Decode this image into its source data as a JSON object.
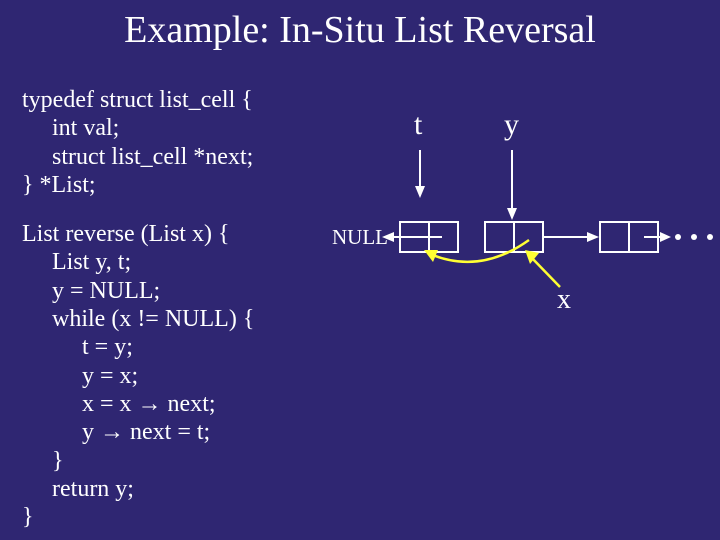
{
  "title": "Example: In-Situ List Reversal",
  "typedef": {
    "l1": "typedef struct list_cell {",
    "l2": "int val;",
    "l3": "struct list_cell *next;",
    "l4": "} *List;"
  },
  "func": {
    "l1": "List reverse (List x) {",
    "l2": "List y, t;",
    "l3": "y = NULL;",
    "l4": "while (x != NULL) {",
    "l5": "t = y;",
    "l6": "y = x;",
    "l7": "x = x → next;",
    "l8": "y → next = t;",
    "l9": "}",
    "l10": "return y;",
    "l11": "}"
  },
  "diagram": {
    "t": "t",
    "y": "y",
    "x": "x",
    "null": "NULL"
  }
}
